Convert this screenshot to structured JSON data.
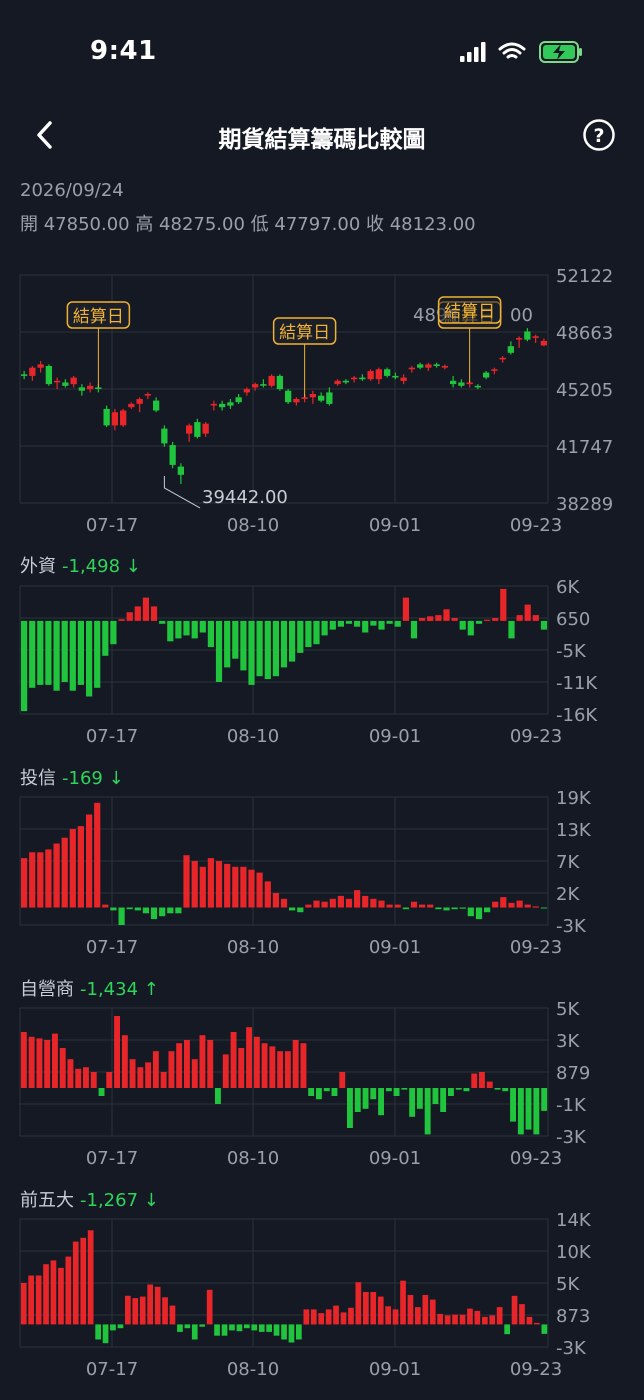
{
  "status": {
    "time": "9:41"
  },
  "nav": {
    "title": "期貨結算籌碼比較圖",
    "back_icon": "chevron-left-icon",
    "help_icon": "help-icon"
  },
  "summary": {
    "date": "2026/09/24",
    "ohlc": "開 47850.00 高 48275.00 低 47797.00 收 48123.00"
  },
  "colors": {
    "up": "#e8262a",
    "down": "#21c43d",
    "background": "#141923",
    "grid": "#2c323d",
    "marker": "#f1b233"
  },
  "x_labels": [
    "07-17",
    "08-10",
    "09-01",
    "09-23"
  ],
  "price_chart": {
    "y_ticks": [
      "52122",
      "48663",
      "45205",
      "41747",
      "38289"
    ],
    "marker_label": "結算日",
    "low_annotation": "39442.00",
    "high_annotation": "4894",
    "annotation_suffix": "00"
  },
  "sections": {
    "foreign": {
      "label": "外資",
      "delta": "-1,498",
      "arrow": "↓",
      "y_ticks": [
        "6K",
        "650",
        "-5K",
        "-11K",
        "-16K"
      ]
    },
    "trust": {
      "label": "投信",
      "delta": "-169",
      "arrow": "↓",
      "y_ticks": [
        "19K",
        "13K",
        "7K",
        "2K",
        "-3K"
      ]
    },
    "dealer": {
      "label": "自營商",
      "delta": "-1,434",
      "arrow": "↑",
      "y_ticks": [
        "5K",
        "3K",
        "879",
        "-1K",
        "-3K"
      ]
    },
    "top5": {
      "label": "前五大",
      "delta": "-1,267",
      "arrow": "↓",
      "y_ticks": [
        "14K",
        "10K",
        "5K",
        "873",
        "-3K"
      ]
    }
  },
  "chart_data": [
    {
      "type": "candlestick",
      "title": "",
      "ylim": [
        38289,
        52122
      ],
      "x_ticks": [
        "07-17",
        "08-10",
        "09-01",
        "09-23"
      ],
      "candles": [
        [
          46100,
          46300,
          45800,
          46000
        ],
        [
          46000,
          46600,
          45700,
          46500
        ],
        [
          46500,
          46900,
          46200,
          46700
        ],
        [
          46600,
          46700,
          45400,
          45500
        ],
        [
          45600,
          45900,
          45200,
          45700
        ],
        [
          45600,
          45800,
          45300,
          45400
        ],
        [
          45500,
          46000,
          45300,
          45900
        ],
        [
          45300,
          45500,
          44800,
          45100
        ],
        [
          45200,
          45600,
          45000,
          45400
        ],
        [
          45300,
          45500,
          45000,
          45200
        ],
        [
          44000,
          44200,
          42900,
          43000
        ],
        [
          43000,
          44000,
          42700,
          43800
        ],
        [
          43000,
          44000,
          42900,
          43900
        ],
        [
          44100,
          44400,
          44000,
          44300
        ],
        [
          44300,
          44700,
          43800,
          44600
        ],
        [
          44800,
          45000,
          44600,
          44900
        ],
        [
          44500,
          44700,
          43800,
          43900
        ],
        [
          42800,
          43000,
          41700,
          41900
        ],
        [
          41800,
          42000,
          40400,
          40600
        ],
        [
          40500,
          40700,
          39442,
          40000
        ],
        [
          42500,
          43100,
          42000,
          43000
        ],
        [
          43200,
          43400,
          42200,
          42300
        ],
        [
          42500,
          43200,
          42300,
          43100
        ],
        [
          44200,
          44500,
          43900,
          44300
        ],
        [
          44300,
          44500,
          43900,
          44100
        ],
        [
          44400,
          44600,
          44000,
          44200
        ],
        [
          44700,
          44900,
          44300,
          44400
        ],
        [
          45000,
          45300,
          44800,
          45200
        ],
        [
          45300,
          45600,
          45100,
          45500
        ],
        [
          45500,
          45800,
          45300,
          45400
        ],
        [
          45400,
          46100,
          45300,
          46000
        ],
        [
          46000,
          46100,
          45100,
          45200
        ],
        [
          45100,
          45200,
          44300,
          44400
        ],
        [
          44400,
          44700,
          44200,
          44600
        ],
        [
          44600,
          44900,
          44400,
          44700
        ],
        [
          44700,
          45100,
          44300,
          44900
        ],
        [
          44800,
          45000,
          44400,
          44500
        ],
        [
          45000,
          45300,
          44200,
          44300
        ],
        [
          45500,
          45800,
          45400,
          45700
        ],
        [
          45700,
          45800,
          45500,
          45600
        ],
        [
          45800,
          46000,
          45600,
          45900
        ],
        [
          45900,
          46100,
          45700,
          45800
        ],
        [
          45800,
          46400,
          45700,
          46300
        ],
        [
          45800,
          46500,
          45500,
          46400
        ],
        [
          46400,
          46500,
          45900,
          46000
        ],
        [
          46000,
          46200,
          45800,
          45900
        ],
        [
          45700,
          46100,
          45500,
          45900
        ],
        [
          46400,
          46600,
          46200,
          46500
        ],
        [
          46700,
          46800,
          46400,
          46500
        ],
        [
          46500,
          46800,
          46300,
          46700
        ],
        [
          46700,
          46800,
          46500,
          46600
        ],
        [
          46500,
          46700,
          46400,
          46600
        ],
        [
          45700,
          46000,
          45300,
          45500
        ],
        [
          45600,
          45800,
          45300,
          45400
        ],
        [
          45500,
          45700,
          45300,
          45600
        ],
        [
          45400,
          45500,
          45200,
          45300
        ],
        [
          46200,
          46300,
          45800,
          45900
        ],
        [
          46300,
          46500,
          46100,
          46400
        ],
        [
          47000,
          47200,
          46800,
          47100
        ],
        [
          47800,
          48100,
          47300,
          47400
        ],
        [
          48200,
          48400,
          47700,
          48300
        ],
        [
          48700,
          48900,
          48100,
          48200
        ],
        [
          48300,
          48500,
          48000,
          48400
        ],
        [
          47850,
          48275,
          47797,
          48123
        ]
      ],
      "settlement_days": [
        9,
        34,
        54
      ]
    },
    {
      "type": "bar",
      "title": "外資",
      "ylim": [
        -16000,
        6000
      ],
      "values": [
        -15500,
        -11500,
        -11000,
        -11000,
        -12000,
        -10500,
        -12000,
        -11000,
        -13000,
        -11500,
        -6000,
        -4000,
        300,
        1500,
        2500,
        4000,
        2500,
        -500,
        -3500,
        -3000,
        -2500,
        -3000,
        -2000,
        -4500,
        -10500,
        -8000,
        -6500,
        -8500,
        -11000,
        -9500,
        -10000,
        -9500,
        -8000,
        -7000,
        -5500,
        -4500,
        -4000,
        -2500,
        -1500,
        -1000,
        -500,
        -1000,
        -2000,
        -800,
        -1500,
        -500,
        -1000,
        4000,
        -3000,
        500,
        800,
        1000,
        2000,
        500,
        -1500,
        -2500,
        -500,
        200,
        500,
        5500,
        -3000,
        1000,
        2800,
        1000,
        -1498
      ]
    },
    {
      "type": "bar",
      "title": "投信",
      "ylim": [
        -3000,
        19000
      ],
      "values": [
        8500,
        9500,
        9500,
        10000,
        11000,
        12000,
        13500,
        14000,
        16000,
        18000,
        500,
        -500,
        -3000,
        -300,
        -500,
        -1000,
        -2000,
        -1500,
        -1000,
        -1000,
        9000,
        8000,
        7000,
        8500,
        8000,
        7500,
        7000,
        7000,
        6500,
        6000,
        4500,
        2500,
        1500,
        -500,
        -800,
        500,
        1200,
        1000,
        1500,
        2000,
        1500,
        3000,
        2000,
        1500,
        1200,
        500,
        500,
        -300,
        1000,
        500,
        500,
        -300,
        -500,
        -300,
        -200,
        -1500,
        -2000,
        -800,
        1000,
        1800,
        800,
        1200,
        500,
        200,
        -169
      ]
    },
    {
      "type": "bar",
      "title": "自營商",
      "ylim": [
        -3000,
        5000
      ],
      "values": [
        3500,
        3200,
        3100,
        3000,
        3400,
        2500,
        1800,
        1200,
        1300,
        1000,
        -500,
        1000,
        4500,
        3300,
        1800,
        1300,
        1600,
        2300,
        1000,
        2300,
        2800,
        3000,
        1800,
        3300,
        3000,
        -1000,
        2100,
        3500,
        2500,
        3800,
        3200,
        2800,
        2600,
        2300,
        2300,
        3000,
        2800,
        -500,
        -700,
        -200,
        -500,
        1000,
        -2500,
        -1500,
        -1300,
        -700,
        -1700,
        -200,
        -500,
        -100,
        -1800,
        -1300,
        -2900,
        -1000,
        -1500,
        -500,
        -100,
        -200,
        900,
        1000,
        400,
        -100,
        -200,
        -2100,
        -2900,
        -2600,
        -2900,
        -1434
      ]
    },
    {
      "type": "bar",
      "title": "前五大",
      "ylim": [
        -3000,
        14000
      ],
      "values": [
        5500,
        6500,
        6500,
        8000,
        8500,
        7500,
        9000,
        11000,
        11500,
        12500,
        -2000,
        -2500,
        -800,
        -500,
        3800,
        3500,
        3700,
        5300,
        5000,
        3600,
        2500,
        -1000,
        -500,
        -2000,
        -300,
        4600,
        -1500,
        -1500,
        -800,
        -900,
        -500,
        -800,
        -1000,
        -1000,
        -1500,
        -2000,
        -2400,
        -2000,
        2000,
        2000,
        1500,
        2000,
        2500,
        1600,
        2200,
        5600,
        4300,
        4300,
        3700,
        2400,
        2000,
        5800,
        3900,
        2300,
        3900,
        3300,
        1400,
        1200,
        1300,
        1300,
        2100,
        1800,
        1000,
        1200,
        2300,
        -1300,
        3800,
        2700,
        1000,
        200,
        -1267
      ]
    }
  ]
}
